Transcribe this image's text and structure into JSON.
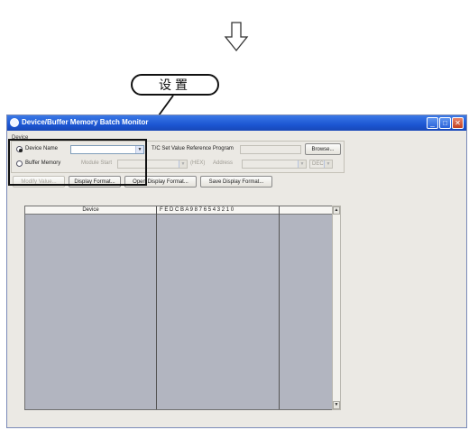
{
  "callout": {
    "label": "设置"
  },
  "window": {
    "title": "Device/Buffer Memory Batch Monitor",
    "device_group_label": "Device",
    "device_name_radio": "Device Name",
    "buffer_memory_radio": "Buffer Memory",
    "module_start_label": "Module Start",
    "hex_label": "(HEX)",
    "address_label": "Address",
    "dec_option": "DEC",
    "tc_label": "T/C Set Value Reference Program",
    "browse_button": "Browse...",
    "buttons": {
      "modify_value": "Modify Value...",
      "display_format": "Display Format...",
      "open_display_format": "Open Display Format...",
      "save_display_format": "Save Display Format..."
    },
    "table": {
      "col_device": "Device",
      "col_bits": "F E D C B A 9 8 7 6 5 4 3 2 1 0"
    }
  },
  "colors": {
    "titlebar": "#1c56d3",
    "window_bg": "#ebe9e4",
    "table_bg": "#b2b5c0"
  }
}
